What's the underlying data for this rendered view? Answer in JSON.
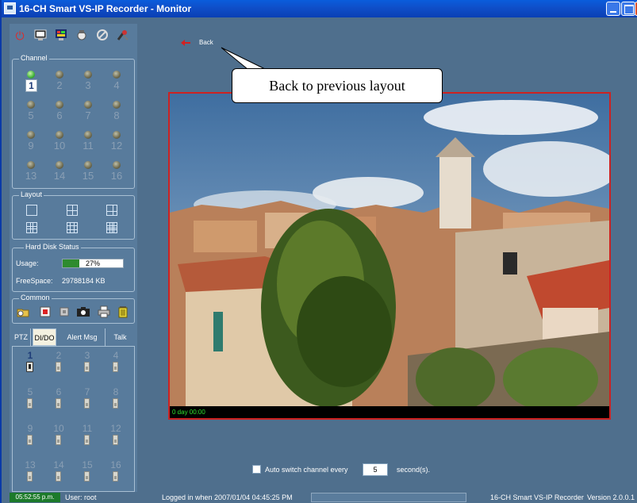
{
  "window": {
    "title": "16-CH Smart VS-IP Recorder - Monitor"
  },
  "toolbar": {
    "icons": [
      "power-icon",
      "monitor-icon",
      "color-icon",
      "network-icon",
      "settings-icon",
      "tools-icon"
    ]
  },
  "channel_group": {
    "label": "Channel",
    "channels": [
      "1",
      "2",
      "3",
      "4",
      "5",
      "6",
      "7",
      "8",
      "9",
      "10",
      "11",
      "12",
      "13",
      "14",
      "15",
      "16"
    ],
    "selected": "1"
  },
  "layout_group": {
    "label": "Layout"
  },
  "disk": {
    "label": "Hard Disk Status",
    "usage_label": "Usage:",
    "usage_pct_text": "27%",
    "usage_fraction": 0.27,
    "free_label": "FreeSpace:",
    "free_value": "29788184 KB"
  },
  "common_group": {
    "label": "Common"
  },
  "tabs": [
    "PTZ",
    "DI/DO",
    "Alert Msg",
    "Talk"
  ],
  "active_tab": "DI/DO",
  "dio": {
    "numbers": [
      "1",
      "2",
      "3",
      "4",
      "5",
      "6",
      "7",
      "8",
      "9",
      "10",
      "11",
      "12",
      "13",
      "14",
      "15",
      "16"
    ]
  },
  "main": {
    "back_label": "Back",
    "callout_text": "Back to previous layout",
    "video_status": "0 day  00:00",
    "auto_switch_label": "Auto switch channel every",
    "seconds_value": "5",
    "seconds_label": "second(s)."
  },
  "statusbar": {
    "clock": "05:52:55 p.m.",
    "user": "User: root",
    "login": "Logged in when  2007/01/04 04:45:25 PM",
    "app_name": "16-CH Smart VS-IP Recorder",
    "version": "Version 2.0.0.1"
  },
  "colors": {
    "accent_red": "#cc2222",
    "usage_green": "#2e8b2e",
    "video_text_green": "#2ee02e"
  }
}
